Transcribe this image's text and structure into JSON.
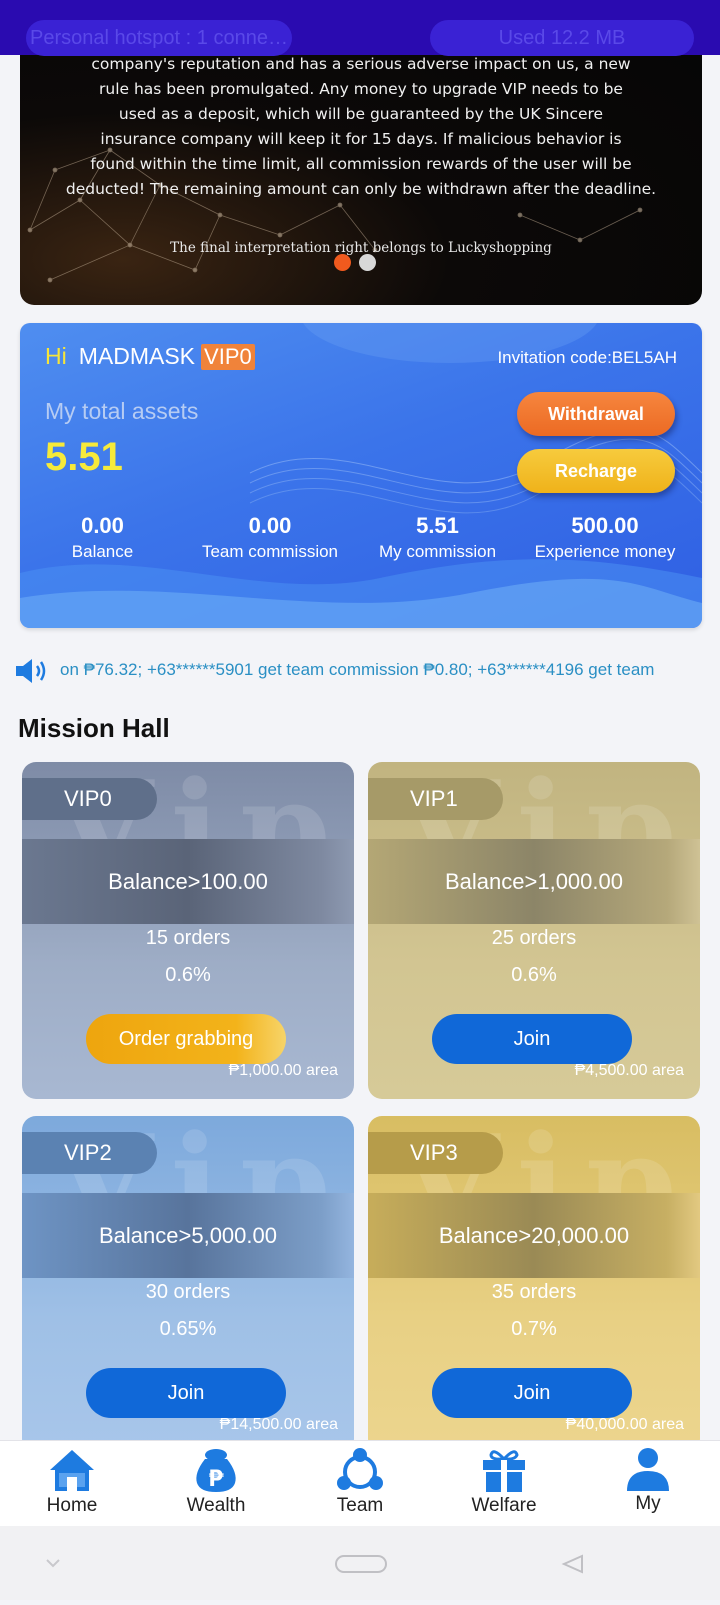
{
  "status_bar": {
    "hotspot": "Personal hotspot : 1 conne…",
    "data_used": "Used  12.2 MB"
  },
  "banner": {
    "lines": [
      "company's reputation and has a serious adverse impact on us, a new",
      "rule has been promulgated. Any money to upgrade VIP needs to be",
      "used as a deposit, which will be guaranteed by the UK Sincere",
      "insurance company will keep it for 15 days. If malicious behavior is",
      "found within the time limit, all commission rewards of the user will be",
      "deducted! The remaining amount can only be withdrawn after the deadline."
    ],
    "footer": "The final interpretation right belongs to Luckyshopping"
  },
  "account": {
    "greeting": "Hi",
    "username": "MADMASK",
    "vip_level": "VIP0",
    "invitation": "Invitation code:BEL5AH",
    "total_label": "My total assets",
    "total_value": "5.51",
    "withdraw_label": "Withdrawal",
    "recharge_label": "Recharge",
    "stats": [
      {
        "value": "0.00",
        "label": "Balance"
      },
      {
        "value": "0.00",
        "label": "Team commission"
      },
      {
        "value": "5.51",
        "label": "My commission"
      },
      {
        "value": "500.00",
        "label": "Experience money"
      }
    ]
  },
  "ticker": {
    "text": "on ₱76.32;  +63******5901 get team commission ₱0.80;  +63******4196 get team"
  },
  "mission_hall": {
    "title": "Mission Hall",
    "watermark": "Vip",
    "cards": [
      {
        "tag": "VIP0",
        "requirement": "Balance>100.00",
        "orders": "15 orders",
        "rate": "0.6%",
        "button": "Order grabbing",
        "area": "₱1,000.00 area"
      },
      {
        "tag": "VIP1",
        "requirement": "Balance>1,000.00",
        "orders": "25 orders",
        "rate": "0.6%",
        "button": "Join",
        "area": "₱4,500.00 area"
      },
      {
        "tag": "VIP2",
        "requirement": "Balance>5,000.00",
        "orders": "30 orders",
        "rate": "0.65%",
        "button": "Join",
        "area": "₱14,500.00 area"
      },
      {
        "tag": "VIP3",
        "requirement": "Balance>20,000.00",
        "orders": "35 orders",
        "rate": "0.7%",
        "button": "Join",
        "area": "₱40,000.00 area"
      }
    ]
  },
  "nav": {
    "items": [
      {
        "label": "Home",
        "icon": "home-icon"
      },
      {
        "label": "Wealth",
        "icon": "wealth-bag-icon"
      },
      {
        "label": "Team",
        "icon": "team-icon"
      },
      {
        "label": "Welfare",
        "icon": "gift-icon"
      },
      {
        "label": "My",
        "icon": "person-icon"
      }
    ],
    "active_color": "#1e7be0"
  }
}
